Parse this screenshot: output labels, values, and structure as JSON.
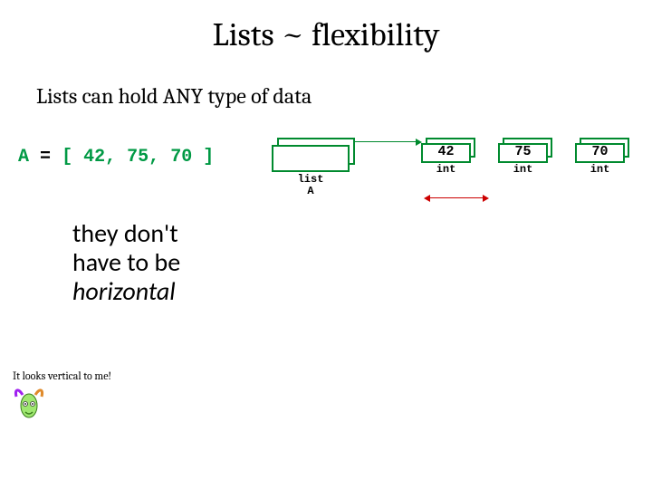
{
  "title": "Lists ~ flexibility",
  "subhead": "Lists can hold ANY type of data",
  "code": {
    "var": "A",
    "eq": "=",
    "open": "[",
    "v1": "42",
    "c": ",",
    "v2": "75",
    "v3": "70",
    "close": "]"
  },
  "diagram": {
    "list_label_top": "list",
    "list_label_bottom": "A",
    "elems": [
      {
        "value": "42",
        "type": "int"
      },
      {
        "value": "75",
        "type": "int"
      },
      {
        "value": "70",
        "type": "int"
      }
    ]
  },
  "note_line1": "they don't",
  "note_line2": "have to be",
  "note_line3_italic": "horizontal",
  "speech": "It looks vertical to me!"
}
